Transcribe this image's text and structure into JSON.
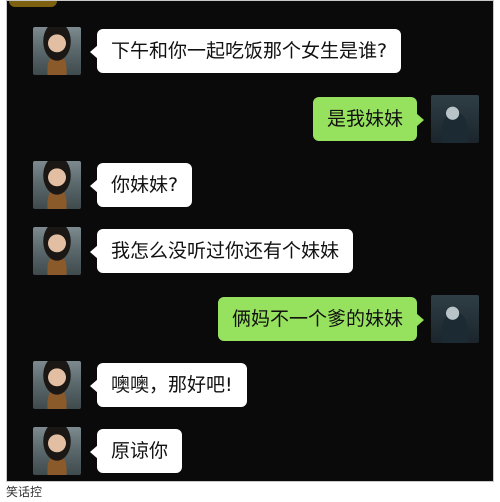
{
  "chat": {
    "messages": [
      {
        "side": "left",
        "text": "下午和你一起吃饭那个女生是谁?"
      },
      {
        "side": "right",
        "text": "是我妹妹"
      },
      {
        "side": "left",
        "text": "你妹妹?"
      },
      {
        "side": "left",
        "text": "我怎么没听过你还有个妹妹"
      },
      {
        "side": "right",
        "text": "俩妈不一个爹的妹妹"
      },
      {
        "side": "left",
        "text": "噢噢，那好吧!"
      },
      {
        "side": "left",
        "text": "原谅你"
      }
    ]
  },
  "footer": {
    "watermark": "笑话控"
  },
  "colors": {
    "background": "#0a0a0a",
    "incoming_bubble": "#ffffff",
    "outgoing_bubble": "#96e15d"
  }
}
